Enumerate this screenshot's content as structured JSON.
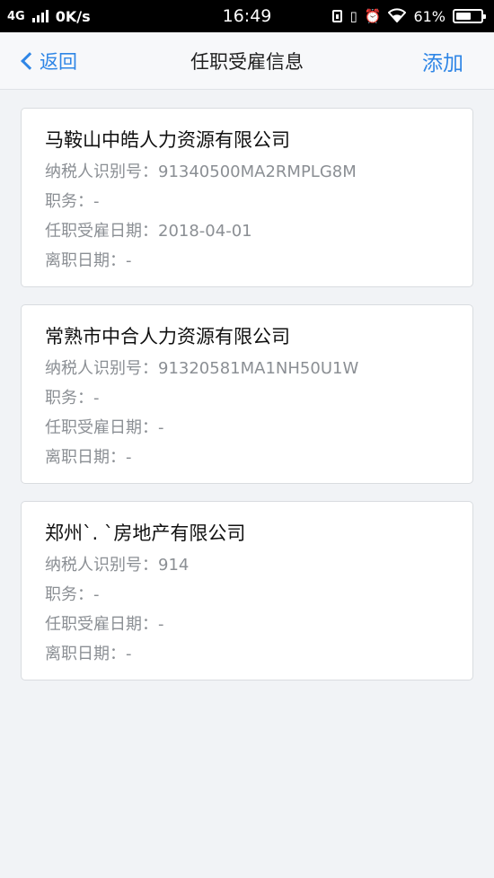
{
  "status_bar": {
    "network": "4G",
    "speed": "0K/s",
    "time": "16:49",
    "battery_percent": "61%",
    "battery_level": 0.61
  },
  "nav": {
    "back_label": "返回",
    "title": "任职受雇信息",
    "add_label": "添加"
  },
  "records": [
    {
      "company": "马鞍山中皓人力资源有限公司",
      "tax_id": "纳税人识别号：91340500MA2RMPLG8M",
      "position": "职务：-",
      "hire_date": "任职受雇日期：2018-04-01",
      "leave_date": "离职日期：-"
    },
    {
      "company": "常熟市中合人力资源有限公司",
      "tax_id": "纳税人识别号：91320581MA1NH50U1W",
      "position": "职务：-",
      "hire_date": "任职受雇日期：-",
      "leave_date": "离职日期：-"
    },
    {
      "company": "郑州`. `房地产有限公司",
      "tax_id": "纳税人识别号：914",
      "position": "职务：-",
      "hire_date": "任职受雇日期：-",
      "leave_date": "离职日期：-"
    }
  ]
}
